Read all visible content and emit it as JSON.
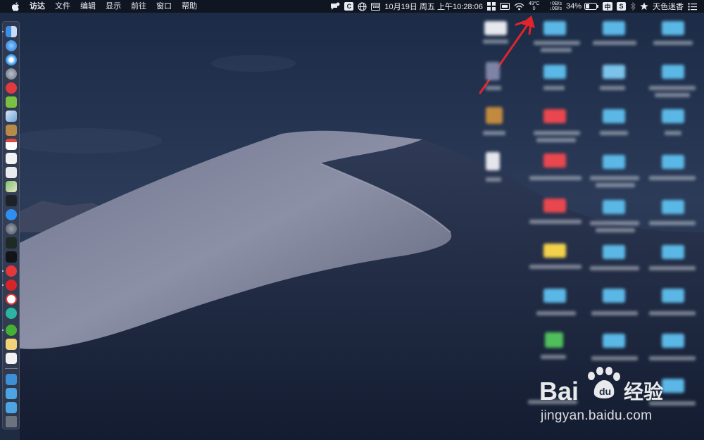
{
  "menubar": {
    "app_name": "访达",
    "menus": [
      "文件",
      "编辑",
      "显示",
      "前往",
      "窗口",
      "帮助"
    ],
    "clock": "10月19日 周五 上午10:28:06",
    "cpu_temp": "49°C",
    "cpu_sub": "0",
    "net_up": "↑0B/s",
    "net_down": "↓0B/s",
    "battery_percent": "34%",
    "input_method": "中",
    "user_name": "天色迷香",
    "c_icon_letter": "C",
    "s_icon_letter": "S"
  },
  "annotation": {
    "color": "#e0242c"
  },
  "watermark": {
    "logo_text": "Bai",
    "logo_suffix": "经验",
    "url": "jingyan.baidu.com"
  },
  "colors": {
    "menubar_bg": "#101522",
    "folder_blue": "#5bb8e6",
    "folder_red": "#e9474f",
    "folder_yellow": "#f2d24a"
  }
}
